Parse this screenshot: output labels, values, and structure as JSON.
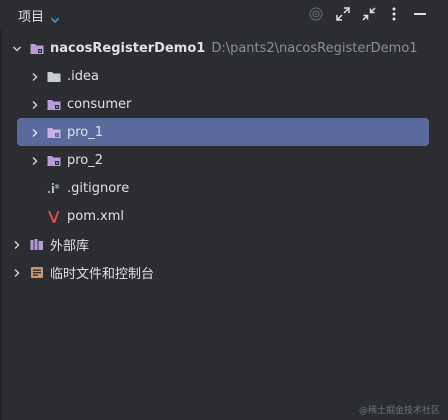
{
  "header": {
    "title": "项目",
    "icons": [
      "target-icon",
      "expand-icon",
      "collapse-icon",
      "more-icon",
      "minimize-icon"
    ]
  },
  "tree": {
    "root": {
      "label": "nacosRegisterDemo1",
      "path": "D:\\pants2\\nacosRegisterDemo1"
    },
    "items": [
      {
        "label": ".idea",
        "icon": "folder-icon"
      },
      {
        "label": "consumer",
        "icon": "module-folder-icon"
      },
      {
        "label": "pro_1",
        "icon": "module-folder-icon",
        "selected": true
      },
      {
        "label": "pro_2",
        "icon": "module-folder-icon"
      },
      {
        "label": ".gitignore",
        "icon": "gitignore-icon"
      },
      {
        "label": "pom.xml",
        "icon": "maven-icon"
      }
    ],
    "external_libraries": "外部库",
    "scratches": "临时文件和控制台"
  },
  "colors": {
    "background": "#2b2d30",
    "selection": "#5b6a9d",
    "text": "#dfe1e5",
    "path": "#8c8f95",
    "module_folder": "#b89bd8",
    "folder": "#c9ccd2",
    "maven": "#e8465b"
  },
  "watermark": "@稀土掘金技术社区"
}
